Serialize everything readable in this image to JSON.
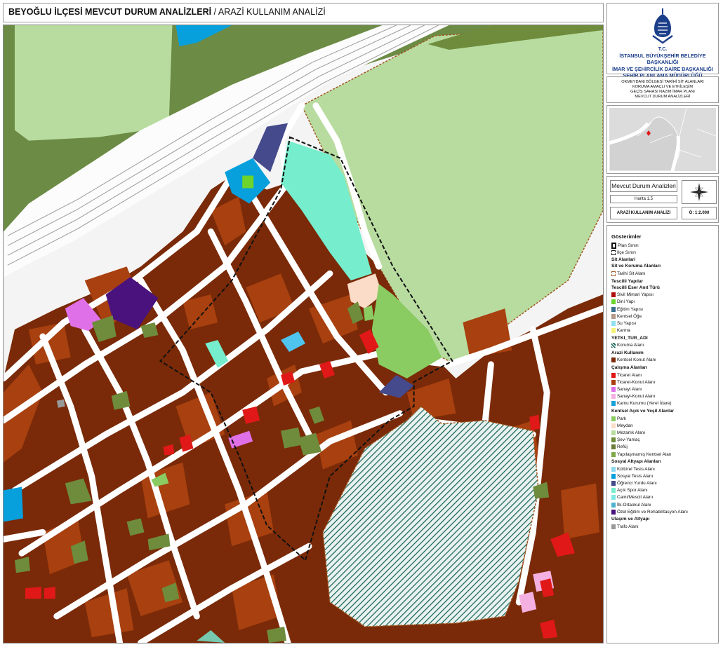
{
  "header": {
    "title_bold": "BEYOĞLU İLÇESİ MEVCUT DURUM ANALİZLERİ",
    "title_rest": " / ARAZİ KULLANIM ANALİZİ"
  },
  "org": {
    "tc": "T.C.",
    "line1": "İSTANBUL BÜYÜKŞEHİR BELEDİYE BAŞKANLIĞI",
    "line2": "İMAR VE ŞEHİRCİLİK DAİRE BAŞKANLIĞI",
    "line3": "ŞEHİR PLANLAMA MÜDÜRLÜĞÜ"
  },
  "project": {
    "line1": "OKMEYDANI BÖLGESİ TARİHİ SİT ALANLARI",
    "line2": "KORUMA AMAÇLI VE ETKİLEŞİM",
    "line3": "GEÇİŞ SAHASI NAZIM İMAR PLANI",
    "line4": "MEVCUT DURUM ANALİZLERİ"
  },
  "info": {
    "analysis": "Mevcut Durum Analizleri",
    "map_no": "Harita 1.5",
    "map_name": "ARAZİ KULLANIM ANALİZİ",
    "scale": "Ö:  1:2.000"
  },
  "legend": {
    "title": "Gösterimler",
    "plan_siniri": "Plan Sınırı",
    "ilce_siniri": "İlçe Sınırı",
    "sit_alanlari": "Sit Alanlari",
    "sit_koruma": "Sit ve Koruma Alanları",
    "tarihi_sit": "Tarihi Sit Alanı",
    "tescilli_yapilar": "Tescilli Yapılar",
    "tescilli_eser": "Tescilli Eser Anıt Türü",
    "sivil": "Sivil Mimari Yapısı",
    "dini": "Dini Yapı",
    "egitim": "Eğitim Yapısı",
    "kentsel_oge": "Kentsel Öğe",
    "su": "Su Yapısı",
    "karma": "Karma",
    "yetki": "YETKI_TUR_ADI",
    "koruma": "Koruma Alanı",
    "arazi": "Arazi Kullanım",
    "kentsel_konut": "Kentsel Konut Alanı",
    "calisma": "Çalışma Alanları",
    "ticaret": "Ticaret Alanı",
    "ticaret_konut": "Ticaret-Konut Alanı",
    "sanayi": "Sanayi Alanı",
    "sanayi_konut": "Sanayi-Konut Alanı",
    "kamu": "Kamu Kurumu (Yerel İdare)",
    "acik_yesil": "Kentsel Açık ve Yeşil Alanlar",
    "park": "Park",
    "meydan": "Meydan",
    "mezarlik": "Mezarlık Alanı",
    "sev": "Şev-Yamaç",
    "refuj": "Refüj",
    "yapilasmamis": "Yapılaşmamış Kentsel Alan",
    "sosyal": "Sosyal Altyapı Alanları",
    "kulturel": "Kültürel Tesis Alanı",
    "sosyal_tesis": "Sosyal Tesis Alanı",
    "ogrenci": "Öğrenci Yurdu Alanı",
    "acik_spor": "Açık Spor Alanı",
    "cami": "Cami/Mescit Alanı",
    "ilk_orta": "İlk-Ortaokul Alanı",
    "ozel_egitim": "Özel Eğitim ve Rehabilitasyon Alanı",
    "ulasim": "Ulaşım ve Altyapı",
    "trafo": "Trafo Alanı"
  },
  "colors": {
    "residential": "#7a2a08",
    "commercial_residential": "#a8400f",
    "commercial": "#e01818",
    "park": "#8acb62",
    "cemetery": "#b8dca0",
    "sports": "#76edcc",
    "dorm": "#454a8c",
    "social": "#08a0dc",
    "special_ed": "#4a127c",
    "slope": "#6e8c3c",
    "refuge": "#6b7c3a",
    "industry": "#e070e8",
    "square": "#fbdcc8",
    "highway": "#6c8b45",
    "cemetery_hatch": "#0f5f55"
  },
  "icons": {
    "logo": "ibb-tulip-logo",
    "north": "north-arrow-icon"
  }
}
